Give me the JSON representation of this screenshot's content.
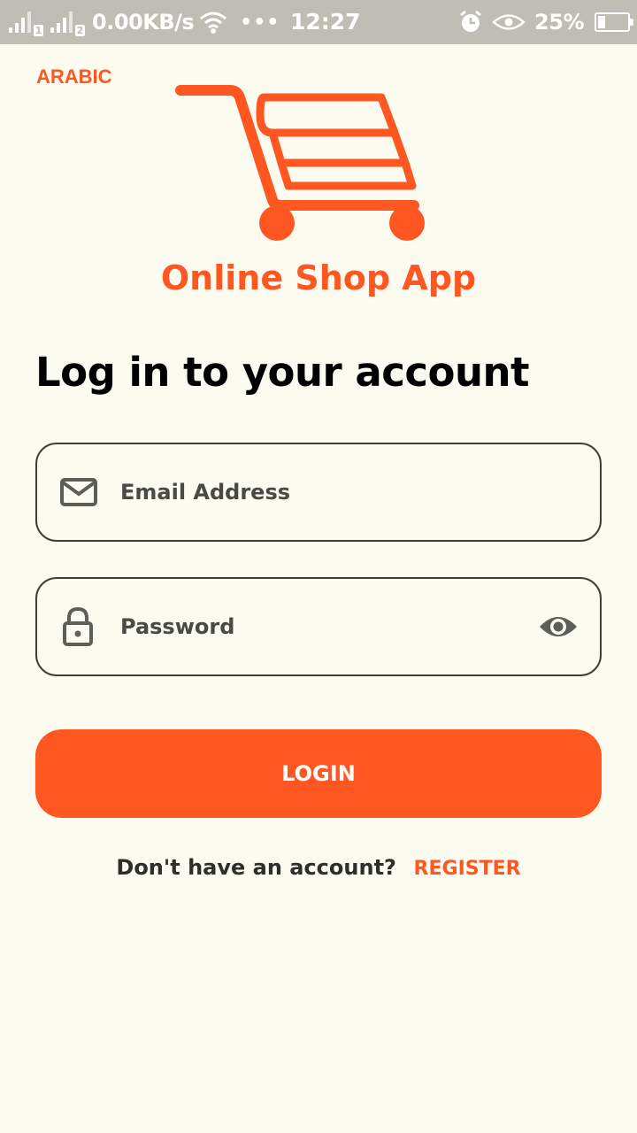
{
  "status_bar": {
    "sim1": "1",
    "sim2": "2",
    "network_speed": "0.00KB/s",
    "more_dots": "•••",
    "time": "12:27",
    "battery": "25%",
    "icons": [
      "signal-icon",
      "signal-icon",
      "wifi-icon",
      "alarm-icon",
      "eye-comfort-icon",
      "battery-icon"
    ]
  },
  "language_link": "ARABIC",
  "app": {
    "name": "Online Shop App",
    "brand_color": "#ff5722",
    "logo_icon": "shopping-cart-icon"
  },
  "form": {
    "heading": "Log in to your account",
    "email": {
      "placeholder": "Email Address",
      "value": "",
      "icon": "mail-icon"
    },
    "password": {
      "placeholder": "Password",
      "value": "",
      "icon": "lock-icon",
      "toggle_icon": "eye-icon"
    },
    "login_label": "LOGIN"
  },
  "register": {
    "prompt": "Don't have an account?",
    "link_label": "REGISTER"
  }
}
